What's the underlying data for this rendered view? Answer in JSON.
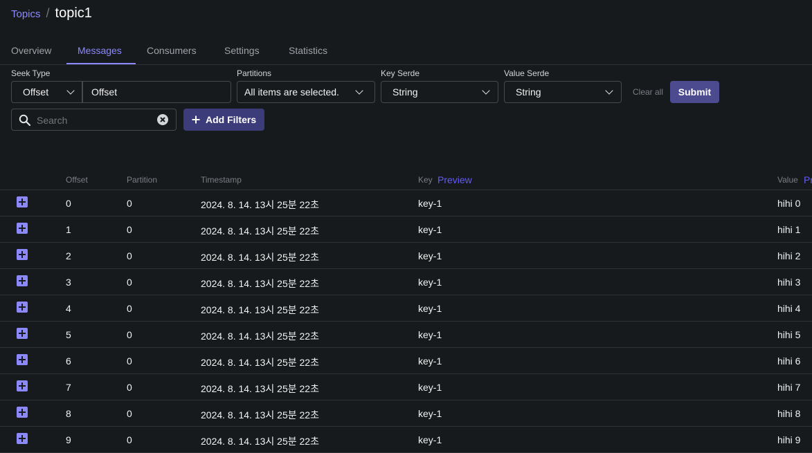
{
  "breadcrumb": {
    "parent": "Topics",
    "separator": "/",
    "current": "topic1"
  },
  "tabs": [
    {
      "label": "Overview",
      "active": false
    },
    {
      "label": "Messages",
      "active": true
    },
    {
      "label": "Consumers",
      "active": false
    },
    {
      "label": "Settings",
      "active": false
    },
    {
      "label": "Statistics",
      "active": false
    }
  ],
  "filters": {
    "seek_type": {
      "label": "Seek Type",
      "value": "Offset",
      "input_value": "Offset"
    },
    "partitions": {
      "label": "Partitions",
      "value": "All items are selected."
    },
    "key_serde": {
      "label": "Key Serde",
      "value": "String"
    },
    "value_serde": {
      "label": "Value Serde",
      "value": "String"
    },
    "clear_label": "Clear all",
    "submit_label": "Submit",
    "search_placeholder": "Search",
    "add_filters_label": "Add Filters"
  },
  "table": {
    "columns": {
      "offset": "Offset",
      "partition": "Partition",
      "timestamp": "Timestamp",
      "key": "Key",
      "value": "Value"
    },
    "key_preview": "Preview",
    "value_preview": "Pr",
    "rows": [
      {
        "offset": "0",
        "partition": "0",
        "timestamp": "2024. 8. 14. 13시 25분 22초",
        "key": "key-1",
        "value": "hihi 0"
      },
      {
        "offset": "1",
        "partition": "0",
        "timestamp": "2024. 8. 14. 13시 25분 22초",
        "key": "key-1",
        "value": "hihi 1"
      },
      {
        "offset": "2",
        "partition": "0",
        "timestamp": "2024. 8. 14. 13시 25분 22초",
        "key": "key-1",
        "value": "hihi 2"
      },
      {
        "offset": "3",
        "partition": "0",
        "timestamp": "2024. 8. 14. 13시 25분 22초",
        "key": "key-1",
        "value": "hihi 3"
      },
      {
        "offset": "4",
        "partition": "0",
        "timestamp": "2024. 8. 14. 13시 25분 22초",
        "key": "key-1",
        "value": "hihi 4"
      },
      {
        "offset": "5",
        "partition": "0",
        "timestamp": "2024. 8. 14. 13시 25분 22초",
        "key": "key-1",
        "value": "hihi 5"
      },
      {
        "offset": "6",
        "partition": "0",
        "timestamp": "2024. 8. 14. 13시 25분 22초",
        "key": "key-1",
        "value": "hihi 6"
      },
      {
        "offset": "7",
        "partition": "0",
        "timestamp": "2024. 8. 14. 13시 25분 22초",
        "key": "key-1",
        "value": "hihi 7"
      },
      {
        "offset": "8",
        "partition": "0",
        "timestamp": "2024. 8. 14. 13시 25분 22초",
        "key": "key-1",
        "value": "hihi 8"
      },
      {
        "offset": "9",
        "partition": "0",
        "timestamp": "2024. 8. 14. 13시 25분 22초",
        "key": "key-1",
        "value": "hihi 9"
      }
    ]
  },
  "colors": {
    "background": "#171a1c",
    "accent": "#8c89ff",
    "submit": "#4d4b8f",
    "preview_link": "#625bf6"
  }
}
